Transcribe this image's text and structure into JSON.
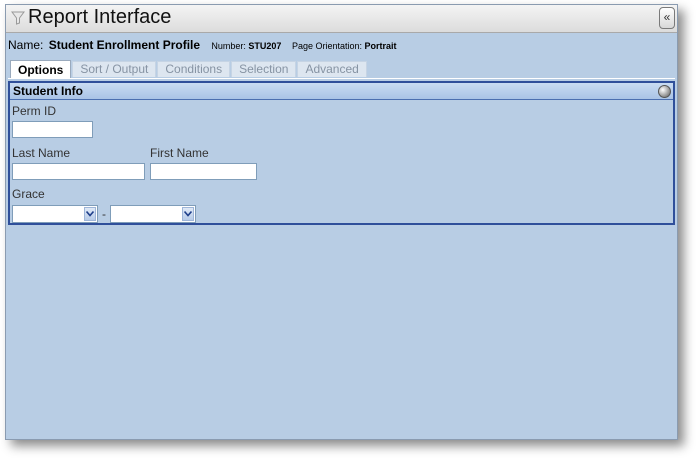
{
  "window": {
    "title": "Report Interface",
    "collapse_label": "«"
  },
  "report": {
    "name_label": "Name:",
    "name_value": "Student Enrollment Profile",
    "number_label": "Number:",
    "number_value": "STU207",
    "orientation_label": "Page Orientation:",
    "orientation_value": "Portrait"
  },
  "tabs": [
    {
      "label": "Options",
      "active": true
    },
    {
      "label": "Sort / Output",
      "active": false
    },
    {
      "label": "Conditions",
      "active": false
    },
    {
      "label": "Selection",
      "active": false
    },
    {
      "label": "Advanced",
      "active": false
    }
  ],
  "panel": {
    "title": "Student Info",
    "fields": {
      "perm_id": {
        "label": "Perm ID",
        "value": ""
      },
      "last_name": {
        "label": "Last Name",
        "value": ""
      },
      "first_name": {
        "label": "First Name",
        "value": ""
      },
      "grade": {
        "label": "Grace",
        "from_value": "",
        "separator": "-",
        "to_value": ""
      }
    }
  },
  "colors": {
    "background": "#b8cde4",
    "panel_border": "#2f4f9a",
    "tab_inactive_text": "#8693a3"
  },
  "icons": {
    "title": "filter-icon",
    "collapse": "chevron-double-left-icon",
    "panel_toggle": "circle-toggle-icon",
    "dropdown": "chevron-down-icon"
  }
}
